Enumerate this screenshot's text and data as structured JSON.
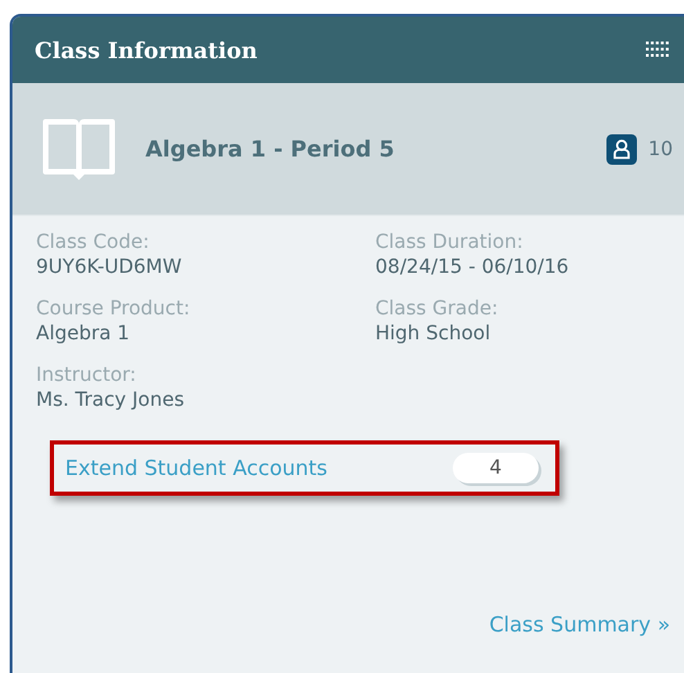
{
  "panel": {
    "title": "Class Information"
  },
  "class": {
    "name": "Algebra 1 - Period 5",
    "student_count": "10"
  },
  "fields": [
    {
      "label": "Class Code:",
      "value": "9UY6K-UD6MW"
    },
    {
      "label": "Class Duration:",
      "value": "08/24/15 - 06/10/16"
    },
    {
      "label": "Course Product:",
      "value": "Algebra 1"
    },
    {
      "label": "Class Grade:",
      "value": "High School"
    },
    {
      "label": "Instructor:",
      "value": "Ms. Tracy Jones"
    }
  ],
  "extend": {
    "label": "Extend Student Accounts",
    "count": "4",
    "highlighted": true
  },
  "footer_link": "Class Summary »"
}
